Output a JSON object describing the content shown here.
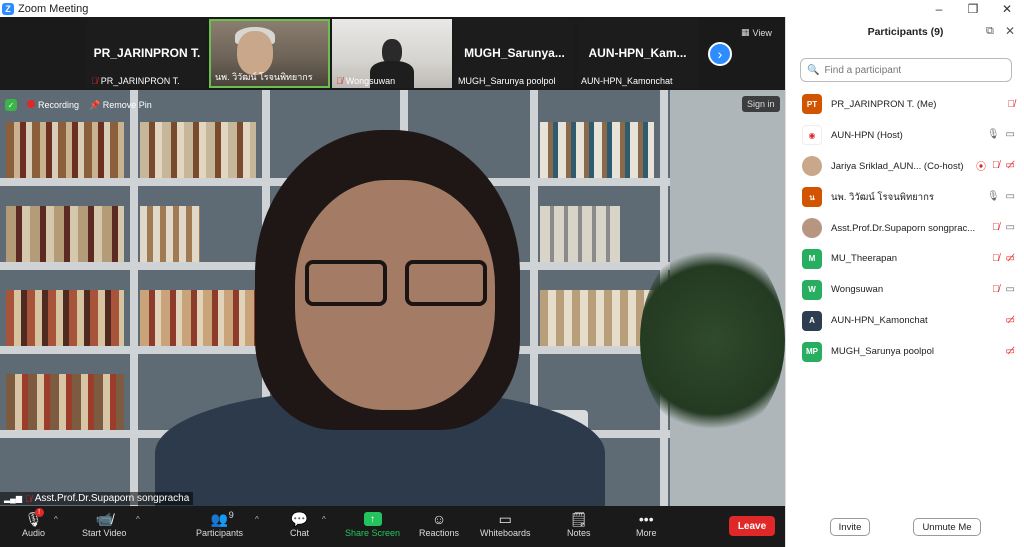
{
  "window": {
    "title": "Zoom Meeting",
    "controls": [
      "–",
      "❐",
      "✕"
    ]
  },
  "thumbnails": [
    {
      "big_name": "PR_JARINPRON T.",
      "label": "PR_JARINPRON T.",
      "muted": true,
      "video": false
    },
    {
      "big_name": "",
      "label": "นพ. วิวัฒน์ โรจนพิทยากร",
      "muted": false,
      "video": true
    },
    {
      "big_name": "",
      "label": "Wongsuwan",
      "muted": true,
      "video": true
    },
    {
      "big_name": "MUGH_Sarunya...",
      "label": "MUGH_Sarunya poolpol",
      "muted": false,
      "video": false
    },
    {
      "big_name": "AUN-HPN_Kam...",
      "label": "AUN-HPN_Kamonchat",
      "muted": false,
      "video": false
    }
  ],
  "view_label": "View",
  "overlay": {
    "recording_label": "Recording",
    "remove_pin_label": "Remove Pin",
    "sign_in_label": "Sign in"
  },
  "active_speaker": "Asst.Prof.Dr.Supaporn songpracha",
  "toolbar": {
    "audio": "Audio",
    "start_video": "Start Video",
    "participants": "Participants",
    "participants_count": "9",
    "chat": "Chat",
    "share_screen": "Share Screen",
    "reactions": "Reactions",
    "whiteboards": "Whiteboards",
    "notes": "Notes",
    "more": "More",
    "leave": "Leave",
    "audio_badge": "!"
  },
  "panel": {
    "title": "Participants (9)",
    "search_placeholder": "Find a participant",
    "participants": [
      {
        "initials": "PT",
        "color": "#d35400",
        "name": "PR_JARINPRON T. (Me)",
        "mic": "",
        "cam": "muted-cam-mic"
      },
      {
        "initials": "",
        "color": "#ffffff",
        "name": "AUN-HPN (Host)",
        "mic": "on",
        "cam": "on",
        "logo": true
      },
      {
        "initials": "",
        "color": "#c9a78a",
        "name": "Jariya Sriklad_AUN... (Co-host)",
        "mic": "rec",
        "cam": "both-off",
        "photo": true
      },
      {
        "initials": "น",
        "color": "#d35400",
        "name": "นพ. วิวัฒน์ โรจนพิทยากร",
        "mic": "on",
        "cam": "on"
      },
      {
        "initials": "",
        "color": "#b89580",
        "name": "Asst.Prof.Dr.Supaporn songprac...",
        "mic": "muted",
        "cam": "on",
        "photo": true
      },
      {
        "initials": "M",
        "color": "#27ae60",
        "name": "MU_Theerapan",
        "mic": "muted",
        "cam": "off"
      },
      {
        "initials": "W",
        "color": "#27ae60",
        "name": "Wongsuwan",
        "mic": "muted",
        "cam": "on"
      },
      {
        "initials": "A",
        "color": "#2c3e50",
        "name": "AUN-HPN_Kamonchat",
        "mic": "",
        "cam": "off"
      },
      {
        "initials": "MP",
        "color": "#27ae60",
        "name": "MUGH_Sarunya poolpol",
        "mic": "",
        "cam": "off"
      }
    ],
    "invite_label": "Invite",
    "unmute_label": "Unmute Me"
  }
}
